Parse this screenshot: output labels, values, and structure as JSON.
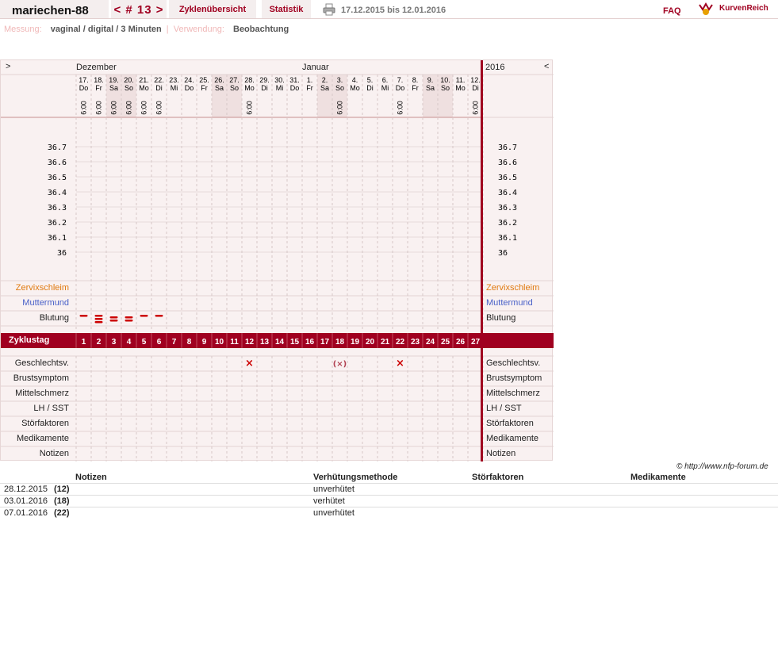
{
  "header": {
    "username": "mariechen-88",
    "cycle_nav": "< # 13 >",
    "tab_overview": "Zyklenübersicht",
    "tab_stats": "Statistik",
    "date_range": "17.12.2015 bis 12.01.2016",
    "faq": "FAQ",
    "logo_text": "KurvenReich"
  },
  "measurement": {
    "label": "Messung:",
    "value": "vaginal / digital / 3 Minuten",
    "sep": "|",
    "use_label": "Verwendung:",
    "use_value": "Beobachtung"
  },
  "chart": {
    "nav_left": ">",
    "nav_right": "<",
    "month_dec": "Dezember",
    "month_jan": "Januar",
    "year": "2016",
    "days": [
      {
        "d": "17.",
        "w": "Do",
        "t": "6:00",
        "we": false
      },
      {
        "d": "18.",
        "w": "Fr",
        "t": "6:00",
        "we": false
      },
      {
        "d": "19.",
        "w": "Sa",
        "t": "6:00",
        "we": true
      },
      {
        "d": "20.",
        "w": "So",
        "t": "6:00",
        "we": true
      },
      {
        "d": "21.",
        "w": "Mo",
        "t": "6:00",
        "we": false
      },
      {
        "d": "22.",
        "w": "Di",
        "t": "6:00",
        "we": false
      },
      {
        "d": "23.",
        "w": "Mi",
        "t": "",
        "we": false
      },
      {
        "d": "24.",
        "w": "Do",
        "t": "",
        "we": false
      },
      {
        "d": "25.",
        "w": "Fr",
        "t": "",
        "we": false
      },
      {
        "d": "26.",
        "w": "Sa",
        "t": "",
        "we": true
      },
      {
        "d": "27.",
        "w": "So",
        "t": "",
        "we": true
      },
      {
        "d": "28.",
        "w": "Mo",
        "t": "6:00",
        "we": false
      },
      {
        "d": "29.",
        "w": "Di",
        "t": "",
        "we": false
      },
      {
        "d": "30.",
        "w": "Mi",
        "t": "",
        "we": false
      },
      {
        "d": "31.",
        "w": "Do",
        "t": "",
        "we": false
      },
      {
        "d": "1.",
        "w": "Fr",
        "t": "",
        "we": false
      },
      {
        "d": "2.",
        "w": "Sa",
        "t": "",
        "we": true
      },
      {
        "d": "3.",
        "w": "So",
        "t": "6:00",
        "we": true
      },
      {
        "d": "4.",
        "w": "Mo",
        "t": "",
        "we": false
      },
      {
        "d": "5.",
        "w": "Di",
        "t": "",
        "we": false
      },
      {
        "d": "6.",
        "w": "Mi",
        "t": "",
        "we": false
      },
      {
        "d": "7.",
        "w": "Do",
        "t": "6:00",
        "we": false
      },
      {
        "d": "8.",
        "w": "Fr",
        "t": "",
        "we": false
      },
      {
        "d": "9.",
        "w": "Sa",
        "t": "",
        "we": true
      },
      {
        "d": "10.",
        "w": "So",
        "t": "",
        "we": true
      },
      {
        "d": "11.",
        "w": "Mo",
        "t": "",
        "we": false
      },
      {
        "d": "12.",
        "w": "Di",
        "t": "6:00",
        "we": false
      }
    ],
    "temps": [
      "36.7",
      "36.6",
      "36.5",
      "36.4",
      "36.3",
      "36.2",
      "36.1",
      "36"
    ],
    "rows_top": [
      "Zervixschleim",
      "Muttermund",
      "Blutung"
    ],
    "cycle_day_label": "Zyklustag",
    "cycle_days": [
      "1",
      "2",
      "3",
      "4",
      "5",
      "6",
      "7",
      "8",
      "9",
      "10",
      "11",
      "12",
      "13",
      "14",
      "15",
      "16",
      "17",
      "18",
      "19",
      "20",
      "21",
      "22",
      "23",
      "24",
      "25",
      "26",
      "27"
    ],
    "bleeding": [
      1,
      3,
      2,
      2,
      1,
      1,
      0,
      0,
      0,
      0,
      0,
      0,
      0,
      0,
      0,
      0,
      0,
      0,
      0,
      0,
      0,
      0,
      0,
      0,
      0,
      0,
      0
    ],
    "rows_bottom": [
      "Geschlechtsv.",
      "Brustsymptom",
      "Mittelschmerz",
      "LH / SST",
      "Störfaktoren",
      "Medikamente",
      "Notizen"
    ],
    "intercourse": {
      "12": "×",
      "18": "(×)",
      "22": "×"
    },
    "copyright": "© http://www.nfp-forum.de"
  },
  "notes_table": {
    "headers": [
      "Notizen",
      "Verhütungsmethode",
      "Störfaktoren",
      "Medikamente"
    ],
    "rows": [
      {
        "date": "28.12.2015",
        "day": "(12)",
        "method": "unverhütet"
      },
      {
        "date": "03.01.2016",
        "day": "(18)",
        "method": "verhütet"
      },
      {
        "date": "07.01.2016",
        "day": "(22)",
        "method": "unverhütet"
      }
    ]
  },
  "colors": {
    "accent": "#a00020",
    "bg": "#f9f1f1",
    "weekend": "#efe0e0",
    "orange": "#e07a10",
    "blue": "#4860c8"
  }
}
